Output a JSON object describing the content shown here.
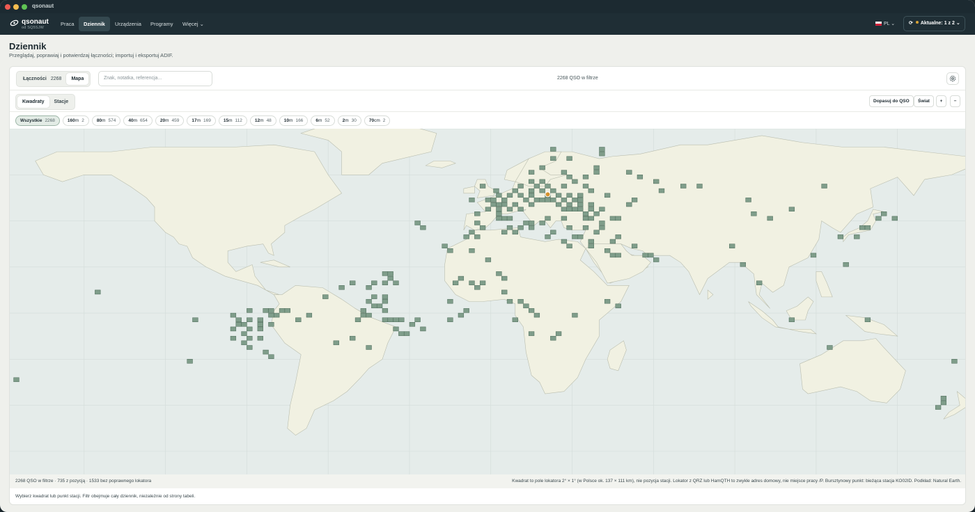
{
  "window": {
    "title": "qsonaut"
  },
  "brand": {
    "name": "qsonaut",
    "sub": "od SQ5SJW"
  },
  "nav": {
    "items": [
      "Praca",
      "Dziennik",
      "Urządzenia",
      "Programy",
      "Więcej ⌄"
    ],
    "active": "Dziennik"
  },
  "lang": {
    "label": "PL ⌄"
  },
  "updates": {
    "label": "Aktualne: 1 z 2 ⌄"
  },
  "page": {
    "title": "Dziennik",
    "subtitle": "Przeglądaj, poprawiaj i potwierdzaj łączności; importuj i eksportuj ADIF."
  },
  "view_toggle": {
    "qso_label": "Łączności",
    "qso_count": "2268",
    "map_label": "Mapa"
  },
  "search": {
    "placeholder": "Znak, notatka, referencja..."
  },
  "filter_count": "2268 QSO w filtrze",
  "map_mode": {
    "squares": "Kwadraty",
    "stations": "Stacje"
  },
  "map_tools": {
    "fit": "Dopasuj do QSO",
    "world": "Świat",
    "zoom_in": "+",
    "zoom_out": "−"
  },
  "bands": [
    {
      "band": "Wszystkie",
      "unit": "",
      "count": "2268",
      "active": true
    },
    {
      "band": "160",
      "unit": "m",
      "count": "2"
    },
    {
      "band": "80",
      "unit": "m",
      "count": "574"
    },
    {
      "band": "40",
      "unit": "m",
      "count": "654"
    },
    {
      "band": "20",
      "unit": "m",
      "count": "459"
    },
    {
      "band": "17",
      "unit": "m",
      "count": "169"
    },
    {
      "band": "15",
      "unit": "m",
      "count": "112"
    },
    {
      "band": "12",
      "unit": "m",
      "count": "48"
    },
    {
      "band": "10",
      "unit": "m",
      "count": "166"
    },
    {
      "band": "6",
      "unit": "m",
      "count": "52"
    },
    {
      "band": "2",
      "unit": "m",
      "count": "30"
    },
    {
      "band": "70",
      "unit": "cm",
      "count": "2"
    }
  ],
  "map_footer": {
    "left": "2268 QSO w filtrze · 735 z pozycją · 1533 bez poprawnego lokatora",
    "right": "Kwadrat to pole lokatora 2° × 1° (w Polsce ok. 137 × 111 km), nie pozycja stacji. Lokator z QRZ lub HamQTH to zwykle adres domowy, nie miejsce pracy /P. Bursztynowy punkt: bieżąca stacja KO02ID. Podkład: Natural Earth."
  },
  "hint": "Wybierz kwadrat lub punkt stacji. Filtr obejmuje cały dziennik, niezależnie od strony tabeli.",
  "colors": {
    "square_fill": "#7f9d8a",
    "square_stroke": "#4d6b59",
    "land": "#f1f1e2",
    "sea": "#e5ecea",
    "current_station": "#d4922e"
  },
  "map_squares": [
    [
      -176,
      -29
    ],
    [
      -146,
      9
    ],
    [
      -112,
      -21
    ],
    [
      -110,
      -3
    ],
    [
      -96,
      -11
    ],
    [
      -96,
      -7
    ],
    [
      -96,
      -1
    ],
    [
      -94,
      -5
    ],
    [
      -94,
      -3
    ],
    [
      -92,
      -13
    ],
    [
      -92,
      -9
    ],
    [
      -92,
      -5
    ],
    [
      -90,
      -15
    ],
    [
      -90,
      -11
    ],
    [
      -90,
      -7
    ],
    [
      -90,
      -3
    ],
    [
      -90,
      1
    ],
    [
      -86,
      -11
    ],
    [
      -86,
      -7
    ],
    [
      -86,
      -5
    ],
    [
      -86,
      -3
    ],
    [
      -84,
      -17
    ],
    [
      -82,
      -19
    ],
    [
      -82,
      -5
    ],
    [
      -82,
      -1
    ],
    [
      -82,
      1
    ],
    [
      -84,
      1
    ],
    [
      -80,
      -1
    ],
    [
      -78,
      1
    ],
    [
      -76,
      1
    ],
    [
      -72,
      -3
    ],
    [
      -68,
      -1
    ],
    [
      -58,
      -13
    ],
    [
      -52,
      -11
    ],
    [
      -46,
      -15
    ],
    [
      -62,
      7
    ],
    [
      -56,
      11
    ],
    [
      -52,
      13
    ],
    [
      -46,
      11
    ],
    [
      -44,
      13
    ],
    [
      -40,
      13
    ],
    [
      -40,
      17
    ],
    [
      -36,
      13
    ],
    [
      -38,
      15
    ],
    [
      -38,
      17
    ],
    [
      -50,
      -3
    ],
    [
      -48,
      -1
    ],
    [
      -48,
      1
    ],
    [
      -46,
      -1
    ],
    [
      -46,
      5
    ],
    [
      -40,
      -3
    ],
    [
      -40,
      1
    ],
    [
      -38,
      -3
    ],
    [
      -40,
      5
    ],
    [
      -42,
      3
    ],
    [
      -44,
      3
    ],
    [
      -44,
      7
    ],
    [
      -40,
      7
    ],
    [
      -36,
      -7
    ],
    [
      -34,
      -9
    ],
    [
      -32,
      -9
    ],
    [
      -34,
      -3
    ],
    [
      -36,
      -3
    ],
    [
      -30,
      -5
    ],
    [
      -28,
      -3
    ],
    [
      -26,
      -7
    ],
    [
      -16,
      -3
    ],
    [
      -12,
      -1
    ],
    [
      -10,
      1
    ],
    [
      -16,
      5
    ],
    [
      -14,
      13
    ],
    [
      -12,
      15
    ],
    [
      -8,
      13
    ],
    [
      -6,
      11
    ],
    [
      -4,
      13
    ],
    [
      -8,
      27
    ],
    [
      -2,
      23
    ],
    [
      2,
      17
    ],
    [
      4,
      15
    ],
    [
      4,
      9
    ],
    [
      6,
      5
    ],
    [
      10,
      5
    ],
    [
      12,
      3
    ],
    [
      8,
      -3
    ],
    [
      14,
      1
    ],
    [
      16,
      -1
    ],
    [
      14,
      -9
    ],
    [
      22,
      -11
    ],
    [
      24,
      -9
    ],
    [
      30,
      -1
    ],
    [
      42,
      5
    ],
    [
      46,
      3
    ],
    [
      -2,
      49
    ],
    [
      1,
      53
    ],
    [
      2,
      43
    ],
    [
      2,
      47
    ],
    [
      2,
      51
    ],
    [
      4,
      41
    ],
    [
      4,
      47
    ],
    [
      6,
      41
    ],
    [
      8,
      53
    ],
    [
      10,
      55
    ],
    [
      14,
      53
    ],
    [
      14,
      57
    ],
    [
      14,
      61
    ],
    [
      18,
      57
    ],
    [
      18,
      63
    ],
    [
      20,
      55
    ],
    [
      22,
      67
    ],
    [
      22,
      71
    ],
    [
      26,
      61
    ],
    [
      26,
      55
    ],
    [
      28,
      59
    ],
    [
      28,
      67
    ],
    [
      30,
      57
    ],
    [
      32,
      49
    ],
    [
      32,
      51
    ],
    [
      34,
      55
    ],
    [
      34,
      59
    ],
    [
      36,
      45
    ],
    [
      36,
      47
    ],
    [
      36,
      53
    ],
    [
      38,
      61
    ],
    [
      38,
      63
    ],
    [
      40,
      69
    ],
    [
      40,
      71
    ],
    [
      -8,
      49
    ],
    [
      -6,
      43
    ],
    [
      -4,
      55
    ],
    [
      -2,
      45
    ],
    [
      0,
      49
    ],
    [
      0,
      47
    ],
    [
      2,
      45
    ],
    [
      4,
      49
    ],
    [
      6,
      51
    ],
    [
      6,
      45
    ],
    [
      8,
      47
    ],
    [
      10,
      45
    ],
    [
      10,
      51
    ],
    [
      12,
      49
    ],
    [
      14,
      47
    ],
    [
      14,
      51
    ],
    [
      16,
      49
    ],
    [
      16,
      55
    ],
    [
      18,
      49
    ],
    [
      18,
      53
    ],
    [
      20,
      49
    ],
    [
      20,
      51
    ],
    [
      22,
      49
    ],
    [
      22,
      53
    ],
    [
      24,
      47
    ],
    [
      24,
      51
    ],
    [
      26,
      45
    ],
    [
      26,
      49
    ],
    [
      28,
      45
    ],
    [
      28,
      47
    ],
    [
      28,
      51
    ],
    [
      30,
      45
    ],
    [
      30,
      49
    ],
    [
      32,
      45
    ],
    [
      32,
      47
    ],
    [
      34,
      43
    ],
    [
      34,
      41
    ],
    [
      36,
      41
    ],
    [
      38,
      43
    ],
    [
      40,
      45
    ],
    [
      42,
      51
    ],
    [
      44,
      41
    ],
    [
      46,
      41
    ],
    [
      50,
      47
    ],
    [
      52,
      49
    ],
    [
      50,
      61
    ],
    [
      54,
      59
    ],
    [
      60,
      57
    ],
    [
      62,
      53
    ],
    [
      70,
      55
    ],
    [
      76,
      55
    ],
    [
      94,
      49
    ],
    [
      96,
      43
    ],
    [
      110,
      45
    ],
    [
      122,
      55
    ],
    [
      142,
      41
    ],
    [
      144,
      43
    ],
    [
      128,
      33
    ],
    [
      134,
      33
    ],
    [
      136,
      37
    ],
    [
      138,
      37
    ],
    [
      130,
      21
    ],
    [
      118,
      25
    ],
    [
      148,
      41
    ],
    [
      102,
      41
    ],
    [
      88,
      29
    ],
    [
      92,
      21
    ],
    [
      98,
      13
    ],
    [
      110,
      -3
    ],
    [
      124,
      -15
    ],
    [
      138,
      -3
    ],
    [
      170,
      -21
    ],
    [
      164,
      -41
    ],
    [
      166,
      -39
    ],
    [
      166,
      -37
    ],
    [
      42,
      27
    ],
    [
      44,
      25
    ],
    [
      46,
      25
    ],
    [
      44,
      31
    ],
    [
      46,
      33
    ],
    [
      52,
      29
    ],
    [
      56,
      25
    ],
    [
      58,
      25
    ],
    [
      60,
      23
    ],
    [
      40,
      39
    ],
    [
      38,
      35
    ],
    [
      40,
      37
    ],
    [
      26,
      31
    ],
    [
      28,
      29
    ],
    [
      30,
      33
    ],
    [
      32,
      33
    ],
    [
      36,
      31
    ],
    [
      36,
      29
    ],
    [
      34,
      37
    ],
    [
      20,
      33
    ],
    [
      22,
      35
    ],
    [
      -16,
      27
    ],
    [
      -18,
      29
    ],
    [
      -26,
      37
    ],
    [
      -28,
      39
    ],
    [
      10,
      37
    ],
    [
      12,
      39
    ],
    [
      14,
      37
    ],
    [
      18,
      39
    ],
    [
      20,
      41
    ],
    [
      6,
      37
    ],
    [
      26,
      41
    ],
    [
      28,
      37
    ],
    [
      -4,
      37
    ],
    [
      -6,
      39
    ],
    [
      -8,
      35
    ],
    [
      -10,
      33
    ],
    [
      -6,
      33
    ],
    [
      2,
      41
    ],
    [
      4,
      35
    ],
    [
      8,
      35
    ],
    [
      14,
      39
    ]
  ],
  "current_station": [
    20,
    51
  ]
}
